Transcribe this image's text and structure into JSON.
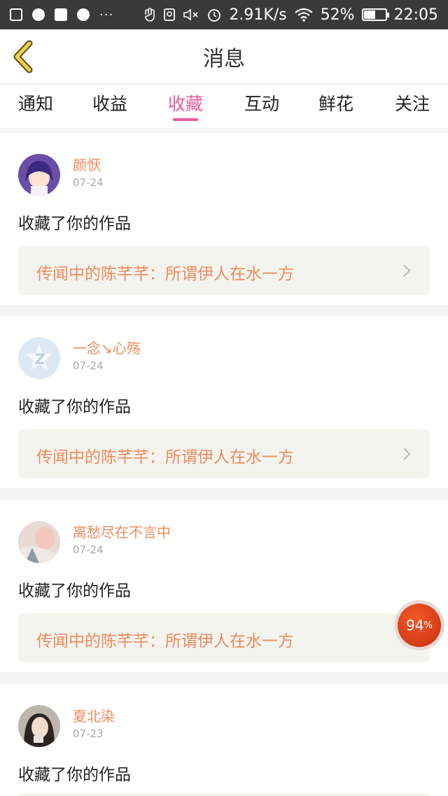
{
  "status_bar": {
    "network_speed": "2.91K/s",
    "battery_text": "52%",
    "battery_level": 0.52,
    "time": "22:05",
    "ellipsis": "···"
  },
  "header": {
    "title": "消息",
    "back_icon": "chevron-left-icon"
  },
  "tabs": [
    {
      "label": "通知",
      "active": false
    },
    {
      "label": "收益",
      "active": false
    },
    {
      "label": "收藏",
      "active": true
    },
    {
      "label": "互动",
      "active": false
    },
    {
      "label": "鲜花",
      "active": false
    },
    {
      "label": "关注",
      "active": false
    }
  ],
  "messages": [
    {
      "user": "颜恹",
      "date": "07-24",
      "action": "收藏了你的作品",
      "work": "传闻中的陈芊芊：所谓伊人在水一方"
    },
    {
      "user": "一念↘心殇",
      "date": "07-24",
      "action": "收藏了你的作品",
      "work": "传闻中的陈芊芊：所谓伊人在水一方"
    },
    {
      "user": "离愁尽在不言中",
      "date": "07-24",
      "action": "收藏了你的作品",
      "work": "传闻中的陈芊芊：所谓伊人在水一方"
    },
    {
      "user": "夏北染",
      "date": "07-23",
      "action": "收藏了你的作品",
      "work": ""
    }
  ],
  "progress_badge": {
    "value": "94",
    "unit": "%",
    "level": 0.94
  },
  "colors": {
    "accent": "#ea5a9b",
    "username": "#ef8a5e",
    "work_bg": "#f4f4ee"
  }
}
